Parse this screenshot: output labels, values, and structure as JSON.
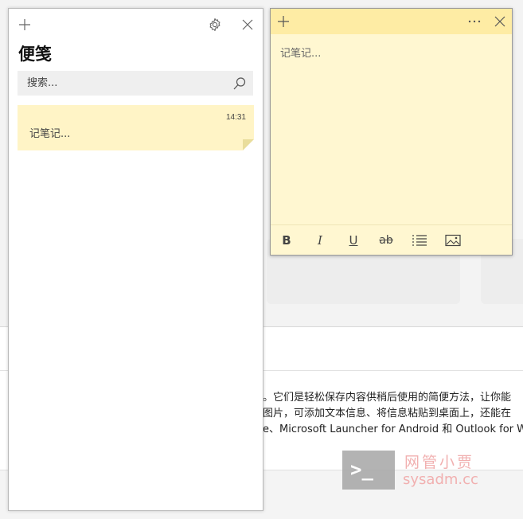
{
  "list_window": {
    "title": "便笺",
    "add_icon": "plus-icon",
    "settings_icon": "gear-icon",
    "close_icon": "close-icon",
    "search": {
      "placeholder": "搜索...",
      "value": "",
      "icon": "search-icon"
    },
    "notes": [
      {
        "time": "14:31",
        "preview": "记笔记..."
      }
    ]
  },
  "note_window": {
    "add_icon": "plus-icon",
    "more_icon": "more-icon",
    "close_icon": "close-icon",
    "placeholder": "记笔记...",
    "toolbar": {
      "bold": "B",
      "italic": "I",
      "underline": "U",
      "strikethrough": "ab",
      "list_icon": "list-icon",
      "image_icon": "image-icon"
    }
  },
  "background": {
    "lines": [
      "。它们是轻松保存内容供稍后使用的简便方法，让你能",
      "图片，可添加文本信息、将信息粘贴到桌面上，还能在",
      "e、Microsoft Launcher for Android 和 Outlook for Wi"
    ],
    "watermark_cn": "网管小贾",
    "watermark_en": "sysadm.cc",
    "watermark_prompt": ">_"
  },
  "colors": {
    "note_header": "#feeca4",
    "note_body": "#fff7d1",
    "note_card": "#fff4c6"
  }
}
